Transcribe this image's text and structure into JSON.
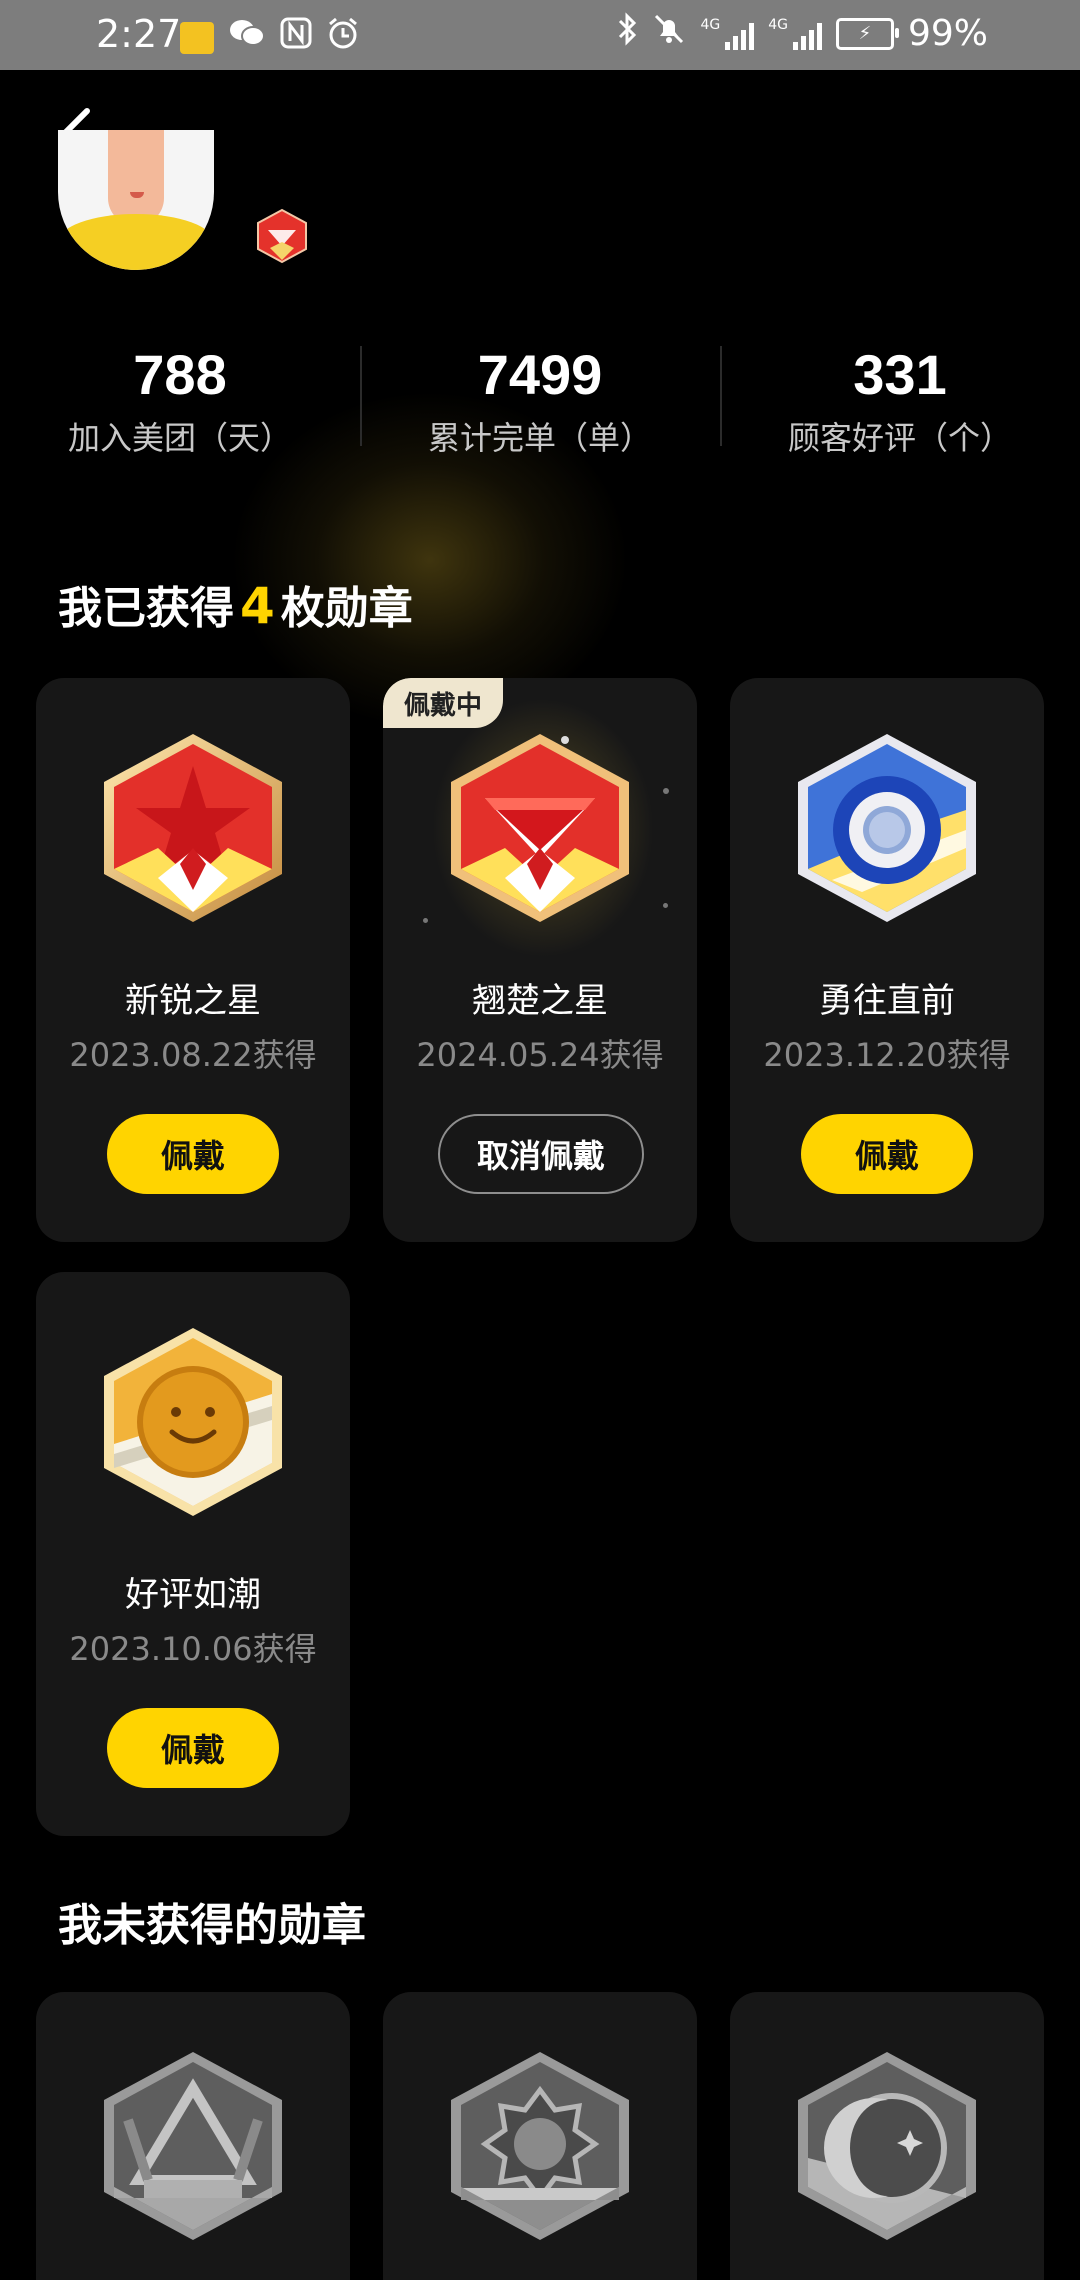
{
  "status_bar": {
    "time": "2:27",
    "battery": "99%",
    "network_tag": "4G"
  },
  "header": {
    "back_icon": "chevron-left-icon"
  },
  "stats": [
    {
      "value": "788",
      "label": "加入美团（天）"
    },
    {
      "value": "7499",
      "label": "累计完单（单）"
    },
    {
      "value": "331",
      "label": "顾客好评（个）"
    }
  ],
  "earned_section": {
    "title_prefix": "我已获得",
    "count": "4",
    "title_suffix": "枚勋章"
  },
  "earned_medals": [
    {
      "name": "新锐之星",
      "date": "2023.08.22获得",
      "button": "佩戴",
      "icon": "red-star-medal-icon"
    },
    {
      "name": "翘楚之星",
      "date": "2024.05.24获得",
      "button": "取消佩戴",
      "tag": "佩戴中",
      "icon": "red-diamond-medal-icon"
    },
    {
      "name": "勇往直前",
      "date": "2023.12.20获得",
      "button": "佩戴",
      "icon": "blue-ring-medal-icon"
    },
    {
      "name": "好评如潮",
      "date": "2023.10.06获得",
      "button": "佩戴",
      "icon": "smiley-medal-icon"
    }
  ],
  "locked_section": {
    "title": "我未获得的勋章"
  },
  "locked_medals": [
    {
      "icon": "locked-crown-medal-icon"
    },
    {
      "icon": "locked-sun-medal-icon"
    },
    {
      "icon": "locked-moon-medal-icon"
    }
  ],
  "colors": {
    "accent": "#ffd400",
    "background": "#000000",
    "card": "#171717"
  }
}
